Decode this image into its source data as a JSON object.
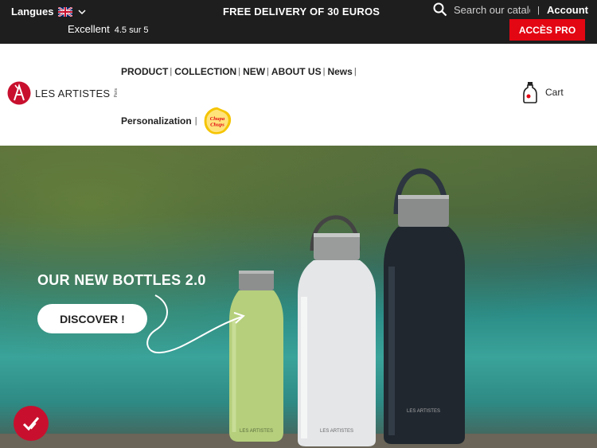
{
  "topbar": {
    "language_label": "Langues",
    "rating_label": "Excellent",
    "rating_score": "4.5 sur 5",
    "promo": "FREE DELIVERY OF 30 EUROS",
    "search_placeholder": "Search our catalog",
    "account": "Account",
    "pro_button": "ACCÈS PRO"
  },
  "header": {
    "logo_text": "LES ARTISTES",
    "logo_sub": "Paris",
    "nav": [
      "PRODUCT",
      "COLLECTION",
      "NEW",
      "ABOUT US",
      "News"
    ],
    "nav_secondary": "Personalization",
    "partner_logo_text": "Chupa Chups",
    "cart": "Cart"
  },
  "hero": {
    "title": "OUR NEW BOTTLES 2.0",
    "cta": "DISCOVER !",
    "bottle_brand": "LES ARTISTES"
  },
  "colors": {
    "accent": "#e30613",
    "topbar_bg": "#1e1e1e"
  }
}
